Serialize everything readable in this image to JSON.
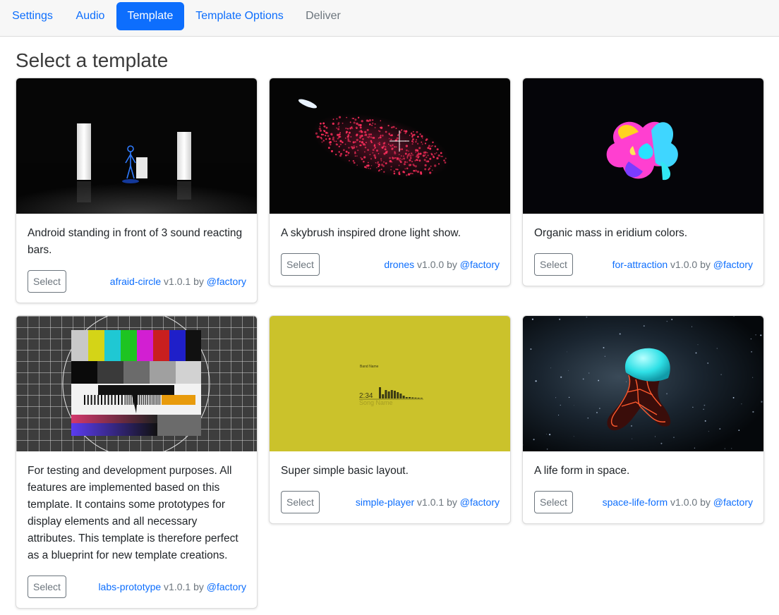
{
  "nav": {
    "tabs": [
      {
        "label": "Settings"
      },
      {
        "label": "Audio"
      },
      {
        "label": "Template"
      },
      {
        "label": "Template Options"
      },
      {
        "label": "Deliver"
      }
    ]
  },
  "page_title": "Select a template",
  "templates": [
    {
      "description": "Android standing in front of 3 sound reacting bars.",
      "button": "Select",
      "name": "afraid-circle",
      "version": "v1.0.1",
      "by": "by",
      "author": "@factory",
      "thumb_icon": "android-bars-thumbnail"
    },
    {
      "description": "A skybrush inspired drone light show.",
      "button": "Select",
      "name": "drones",
      "version": "v1.0.0",
      "by": "by",
      "author": "@factory",
      "thumb_icon": "drone-swarm-thumbnail"
    },
    {
      "description": "Organic mass in eridium colors.",
      "button": "Select",
      "name": "for-attraction",
      "version": "v1.0.0",
      "by": "by",
      "author": "@factory",
      "thumb_icon": "organic-mass-thumbnail"
    },
    {
      "description": "For testing and development purposes. All features are implemented based on this template. It contains some prototypes for display elements and all necessary attributes. This template is therefore perfect as a blueprint for new template creations.",
      "button": "Select",
      "name": "labs-prototype",
      "version": "v1.0.1",
      "by": "by",
      "author": "@factory",
      "thumb_icon": "test-pattern-thumbnail"
    },
    {
      "description": "Super simple basic layout.",
      "button": "Select",
      "name": "simple-player",
      "version": "v1.0.1",
      "by": "by",
      "author": "@factory",
      "thumb_icon": "simple-player-thumbnail",
      "thumb_text": {
        "band": "Band Name",
        "time": "2:34",
        "song": "Song Name"
      }
    },
    {
      "description": "A life form in space.",
      "button": "Select",
      "name": "space-life-form",
      "version": "v1.0.0",
      "by": "by",
      "author": "@factory",
      "thumb_icon": "space-life-form-thumbnail"
    }
  ],
  "colors": {
    "accent": "#0d6efd",
    "muted": "#6c757d",
    "player_bg": "#cbc22b"
  }
}
